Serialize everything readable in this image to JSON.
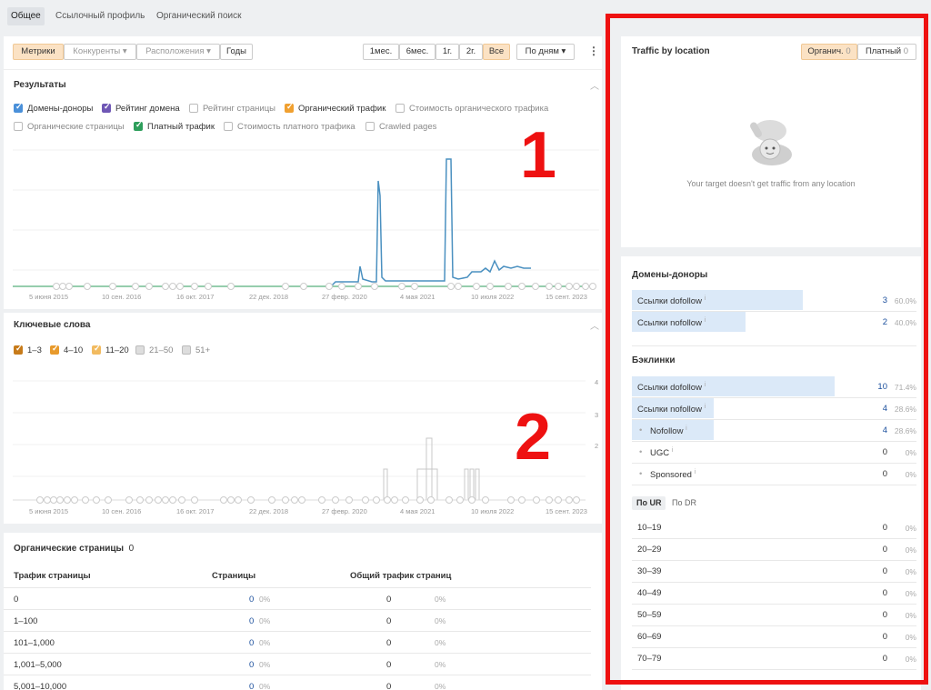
{
  "tabs": [
    {
      "label": "Общее",
      "active": true
    },
    {
      "label": "Ссылочный профиль",
      "active": false
    },
    {
      "label": "Органический поиск",
      "active": false
    }
  ],
  "toolbar": {
    "metrics": "Метрики",
    "competitors": "Конкуренты",
    "locations": "Расположения",
    "years": "Годы",
    "periods": [
      "1мес.",
      "6мес.",
      "1г.",
      "2г.",
      "Все"
    ],
    "interval": "По дням"
  },
  "results": {
    "title": "Результаты",
    "checkboxes": [
      {
        "label": "Домены-доноры",
        "checked": true,
        "color": "#4a90d9"
      },
      {
        "label": "Рейтинг домена",
        "checked": true,
        "color": "#6f57b5"
      },
      {
        "label": "Рейтинг страницы",
        "checked": false
      },
      {
        "label": "Органический трафик",
        "checked": true,
        "color": "#f0a030"
      },
      {
        "label": "Стоимость органического трафика",
        "checked": false
      },
      {
        "label": "Органические страницы",
        "checked": false
      },
      {
        "label": "Платный трафик",
        "checked": true,
        "color": "#2e9e5b"
      },
      {
        "label": "Стоимость платного трафика",
        "checked": false
      },
      {
        "label": "Crawled pages",
        "checked": false
      }
    ],
    "x_labels": [
      "5 июня 2015",
      "10 сен. 2016",
      "16 окт. 2017",
      "22 дек. 2018",
      "27 февр. 2020",
      "4 мая 2021",
      "10 июля 2022",
      "15 сент. 2023"
    ]
  },
  "keywords": {
    "title": "Ключевые слова",
    "checkboxes": [
      {
        "label": "1–3",
        "checked": true,
        "color": "#c77b1a"
      },
      {
        "label": "4–10",
        "checked": true,
        "color": "#e89a2c"
      },
      {
        "label": "11–20",
        "checked": true,
        "color": "#f2bb60"
      },
      {
        "label": "21–50",
        "checked": false
      },
      {
        "label": "51+",
        "checked": false
      }
    ],
    "x_labels": [
      "5 июня 2015",
      "10 сен. 2016",
      "16 окт. 2017",
      "22 дек. 2018",
      "27 февр. 2020",
      "4 мая 2021",
      "10 июля 2022",
      "15 сент. 2023"
    ],
    "y_labels": [
      "4",
      "3",
      "2"
    ]
  },
  "organic_pages": {
    "title": "Органические страницы",
    "count": "0",
    "headers": [
      "Трафик страницы",
      "Страницы",
      "Общий трафик страниц"
    ],
    "rows": [
      {
        "range": "0",
        "pages": "0",
        "pages_pct": "0%",
        "traffic": "0",
        "traffic_pct": "0%"
      },
      {
        "range": "1–100",
        "pages": "0",
        "pages_pct": "0%",
        "traffic": "0",
        "traffic_pct": "0%"
      },
      {
        "range": "101–1,000",
        "pages": "0",
        "pages_pct": "0%",
        "traffic": "0",
        "traffic_pct": "0%"
      },
      {
        "range": "1,001–5,000",
        "pages": "0",
        "pages_pct": "0%",
        "traffic": "0",
        "traffic_pct": "0%"
      },
      {
        "range": "5,001–10,000",
        "pages": "0",
        "pages_pct": "0%",
        "traffic": "0",
        "traffic_pct": "0%"
      }
    ]
  },
  "traffic_location": {
    "title": "Traffic by location",
    "organic_label": "Органич.",
    "organic_count": "0",
    "paid_label": "Платный",
    "paid_count": "0",
    "empty_text": "Your target doesn't get traffic from any location"
  },
  "donors": {
    "title": "Домены-доноры",
    "rows": [
      {
        "label": "Ссылки dofollow",
        "value": "3",
        "pct": "60.0%",
        "fill": 0.6
      },
      {
        "label": "Ссылки nofollow",
        "value": "2",
        "pct": "40.0%",
        "fill": 0.4
      }
    ]
  },
  "backlinks": {
    "title": "Бэклинки",
    "rows": [
      {
        "label": "Ссылки dofollow",
        "value": "10",
        "pct": "71.4%",
        "fill": 0.714,
        "sub": false
      },
      {
        "label": "Ссылки nofollow",
        "value": "4",
        "pct": "28.6%",
        "fill": 0.286,
        "sub": false
      },
      {
        "label": "Nofollow",
        "value": "4",
        "pct": "28.6%",
        "fill": 0.286,
        "sub": true
      },
      {
        "label": "UGC",
        "value": "0",
        "pct": "0%",
        "fill": 0,
        "sub": true
      },
      {
        "label": "Sponsored",
        "value": "0",
        "pct": "0%",
        "fill": 0,
        "sub": true
      }
    ]
  },
  "ur_tabs": {
    "active": "По UR",
    "other": "По DR"
  },
  "ur_rows": [
    {
      "range": "10–19",
      "value": "0",
      "pct": "0%"
    },
    {
      "range": "20–29",
      "value": "0",
      "pct": "0%"
    },
    {
      "range": "30–39",
      "value": "0",
      "pct": "0%"
    },
    {
      "range": "40–49",
      "value": "0",
      "pct": "0%"
    },
    {
      "range": "50–59",
      "value": "0",
      "pct": "0%"
    },
    {
      "range": "60–69",
      "value": "0",
      "pct": "0%"
    },
    {
      "range": "70–79",
      "value": "0",
      "pct": "0%"
    }
  ],
  "annotations": {
    "one": "1",
    "two": "2"
  },
  "colors": {
    "highlight": "#ee1111",
    "bar": "#dbe9f8",
    "line": "#4a90c0"
  }
}
